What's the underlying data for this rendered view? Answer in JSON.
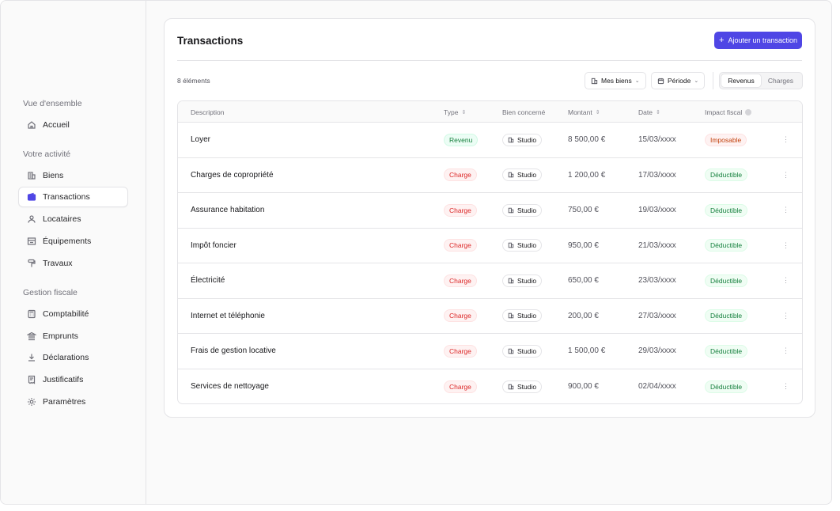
{
  "sidebar": {
    "groups": [
      {
        "label": "Vue d'ensemble"
      },
      {
        "label": "Votre activité"
      },
      {
        "label": "Gestion fiscale"
      }
    ],
    "items": [
      {
        "label": "Accueil",
        "icon": "home-icon"
      },
      {
        "label": "Biens",
        "icon": "building-icon"
      },
      {
        "label": "Transactions",
        "icon": "wallet-icon"
      },
      {
        "label": "Locataires",
        "icon": "user-icon"
      },
      {
        "label": "Équipements",
        "icon": "equipment-icon"
      },
      {
        "label": "Travaux",
        "icon": "paint-roller-icon"
      },
      {
        "label": "Comptabilité",
        "icon": "calculator-icon"
      },
      {
        "label": "Emprunts",
        "icon": "bank-icon"
      },
      {
        "label": "Déclarations",
        "icon": "download-icon"
      },
      {
        "label": "Justificatifs",
        "icon": "receipt-icon"
      },
      {
        "label": "Paramètres",
        "icon": "settings-icon"
      }
    ],
    "active_item": "Transactions"
  },
  "main": {
    "title": "Transactions",
    "add_button": "Ajouter un transaction",
    "count": "8 éléments",
    "filters": {
      "properties": "Mes biens",
      "period": "Période"
    },
    "toggle": {
      "left": "Revenus",
      "right": "Charges",
      "selected": "Revenus"
    }
  },
  "table": {
    "headers": {
      "description": "Description",
      "type": "Type",
      "property": "Bien concerné",
      "amount": "Montant",
      "date": "Date",
      "fiscal": "Impact fiscal"
    },
    "rows": [
      {
        "description": "Loyer",
        "type": "Revenu",
        "property": "Studio",
        "amount": "8 500,00 €",
        "date": "15/03/xxxx",
        "fiscal": "Imposable"
      },
      {
        "description": "Charges de copropriété",
        "type": "Charge",
        "property": "Studio",
        "amount": "1 200,00 €",
        "date": "17/03/xxxx",
        "fiscal": "Déductible"
      },
      {
        "description": "Assurance habitation",
        "type": "Charge",
        "property": "Studio",
        "amount": "750,00 €",
        "date": "19/03/xxxx",
        "fiscal": "Déductible"
      },
      {
        "description": "Impôt foncier",
        "type": "Charge",
        "property": "Studio",
        "amount": "950,00 €",
        "date": "21/03/xxxx",
        "fiscal": "Déductible"
      },
      {
        "description": "Électricité",
        "type": "Charge",
        "property": "Studio",
        "amount": "650,00 €",
        "date": "23/03/xxxx",
        "fiscal": "Déductible"
      },
      {
        "description": "Internet et téléphonie",
        "type": "Charge",
        "property": "Studio",
        "amount": "200,00 €",
        "date": "27/03/xxxx",
        "fiscal": "Déductible"
      },
      {
        "description": "Frais de gestion locative",
        "type": "Charge",
        "property": "Studio",
        "amount": "1 500,00 €",
        "date": "29/03/xxxx",
        "fiscal": "Déductible"
      },
      {
        "description": "Services de nettoyage",
        "type": "Charge",
        "property": "Studio",
        "amount": "900,00 €",
        "date": "02/04/xxxx",
        "fiscal": "Déductible"
      }
    ]
  },
  "colors": {
    "accent": "#4f46e5",
    "revenue": "#15803d",
    "charge": "#dc2626"
  }
}
